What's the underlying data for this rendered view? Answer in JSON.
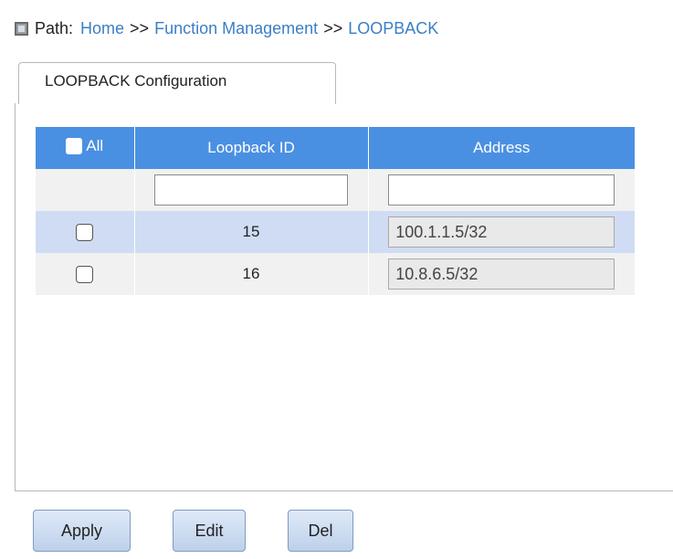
{
  "path": {
    "label": "Path:",
    "crumbs": [
      "Home",
      "Function Management",
      "LOOPBACK"
    ],
    "separator": ">>"
  },
  "tab": {
    "label": "LOOPBACK Configuration"
  },
  "table": {
    "select_all_label": "All",
    "headers": [
      "Loopback ID",
      "Address"
    ],
    "filter": {
      "loopback_id": "",
      "address": ""
    },
    "rows": [
      {
        "checked": false,
        "loopback_id": "15",
        "address": "100.1.1.5/32"
      },
      {
        "checked": false,
        "loopback_id": "16",
        "address": "10.8.6.5/32"
      }
    ]
  },
  "buttons": {
    "apply": "Apply",
    "edit": "Edit",
    "del": "Del"
  },
  "colors": {
    "header_bg": "#4a90e2",
    "selected_row": "#cfdcf3",
    "link": "#3b7fc4"
  }
}
